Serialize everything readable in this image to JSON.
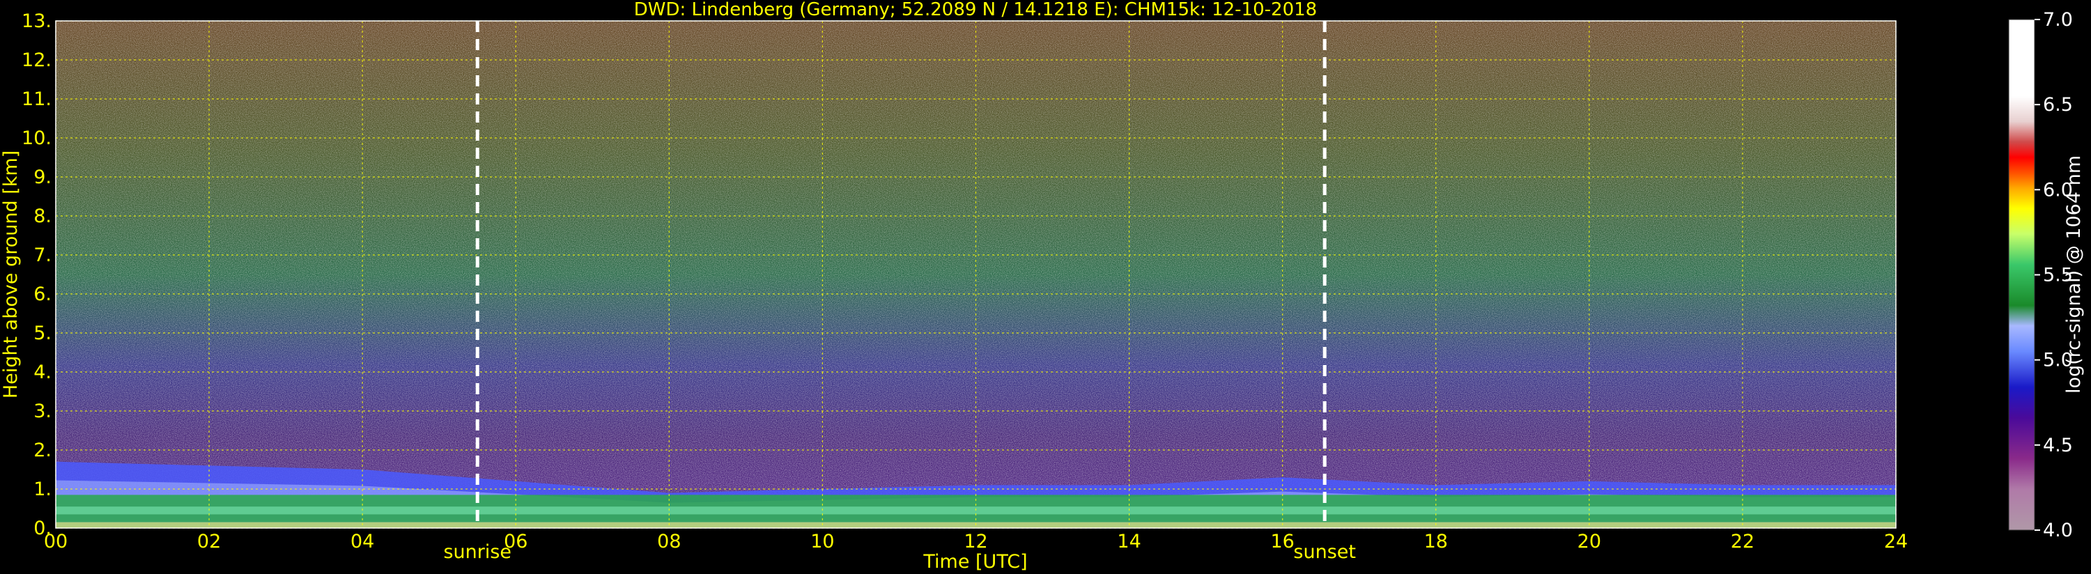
{
  "chart_data": {
    "type": "heatmap",
    "title": "DWD: Lindenberg (Germany; 52.2089 N / 14.1218 E):    CHM15k: 12-10-2018",
    "xlabel": "Time [UTC]",
    "ylabel": "Height above ground [km]",
    "xlim": [
      0,
      24
    ],
    "ylim": [
      0,
      13
    ],
    "x_ticks": [
      "00",
      "02",
      "04",
      "06",
      "08",
      "10",
      "12",
      "14",
      "16",
      "18",
      "20",
      "22",
      "24"
    ],
    "y_ticks": [
      "0.",
      "1.",
      "2.",
      "3.",
      "4.",
      "5.",
      "6.",
      "7.",
      "8.",
      "9.",
      "10.",
      "11.",
      "12.",
      "13."
    ],
    "grid": true,
    "annotations": [
      {
        "label": "sunrise",
        "x": 5.5
      },
      {
        "label": "sunset",
        "x": 16.55
      }
    ],
    "colorbar": {
      "label": "log(rc-signal) @ 1064 nm",
      "range": [
        4.0,
        7.0
      ],
      "ticks": [
        "4.0",
        "4.5",
        "5.0",
        "5.5",
        "6.0",
        "6.5",
        "7.0"
      ]
    },
    "layers_description": {
      "boundary_layer_top_km": [
        1.7,
        1.6,
        1.5,
        1.2,
        0.9,
        1.0,
        1.1,
        1.1,
        1.3,
        1.1,
        1.2,
        1.1,
        1.1
      ]
    }
  },
  "colors": {
    "text": "#ffff00",
    "grid": "#ffff00",
    "background": "#000000",
    "annotation_line": "#ffffff"
  }
}
